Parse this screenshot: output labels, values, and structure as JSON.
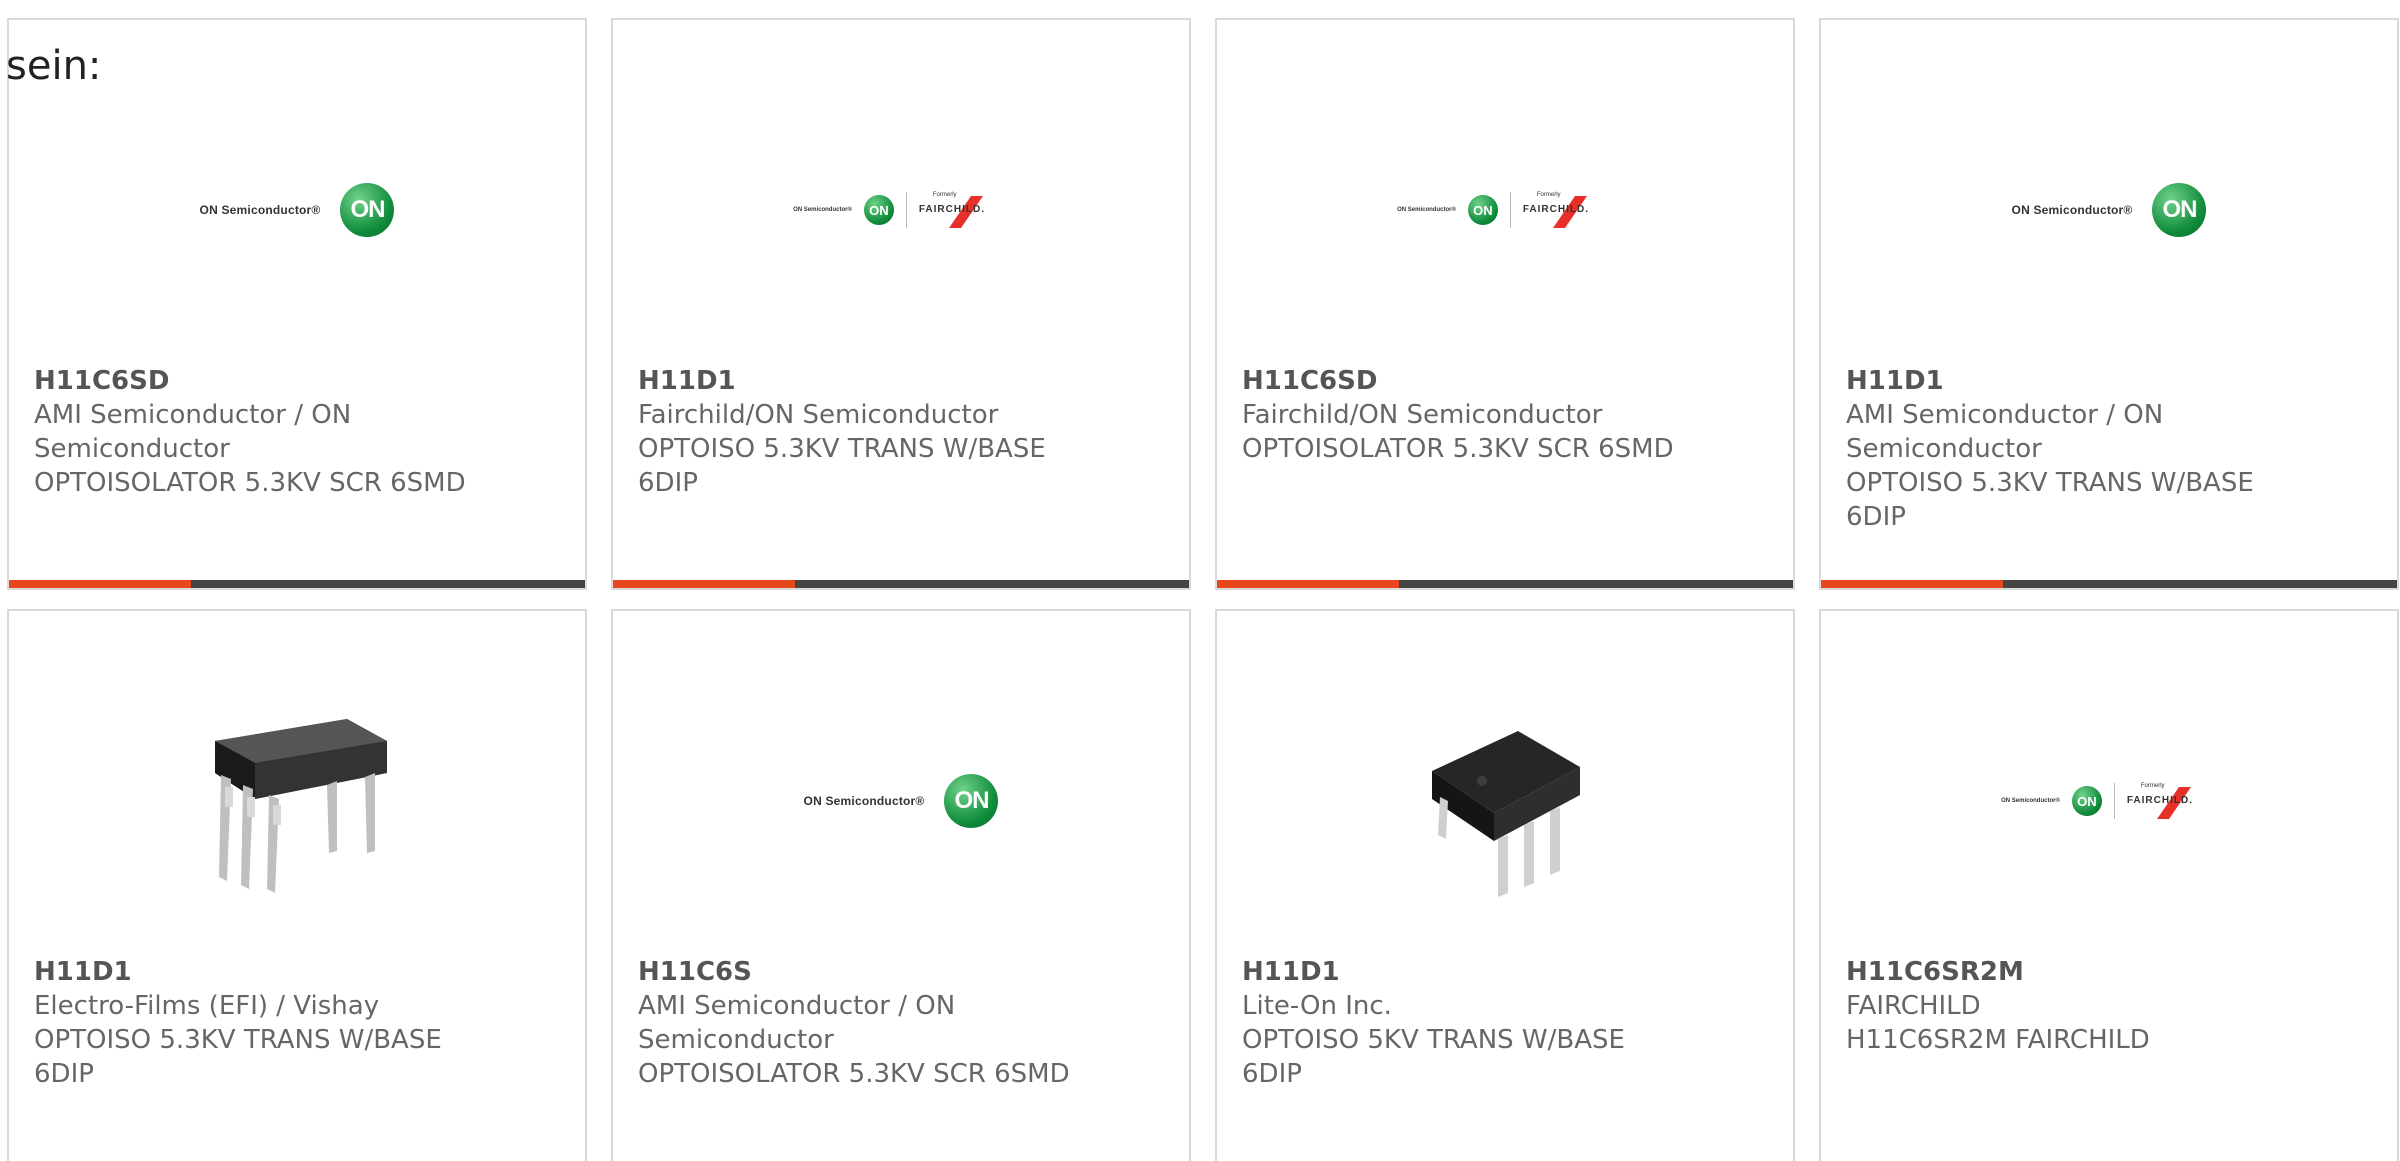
{
  "intro_text": "sein:",
  "brand_colors": {
    "accent": "#e8461c",
    "bar": "#444444",
    "on_green": "#0f8a3a",
    "fairchild_red": "#e8302a"
  },
  "products": [
    {
      "part_number": "H11C6SD",
      "manufacturer_lines": [
        "AMI Semiconductor / ON",
        "Semiconductor"
      ],
      "description_lines": [
        "OPTOISOLATOR 5.3KV SCR 6SMD"
      ],
      "image": "on-semiconductor-logo",
      "logo": {
        "brand": "ON Semiconductor®",
        "mark": "ON"
      }
    },
    {
      "part_number": "H11D1",
      "manufacturer_lines": [
        "Fairchild/ON Semiconductor"
      ],
      "description_lines": [
        "OPTOISO 5.3KV TRANS W/BASE",
        "6DIP"
      ],
      "image": "on-fairchild-logo",
      "logo": {
        "brand": "ON Semiconductor®",
        "mark": "ON",
        "small": "Formerly",
        "word": "FAIRCHILD."
      }
    },
    {
      "part_number": "H11C6SD",
      "manufacturer_lines": [
        "Fairchild/ON Semiconductor"
      ],
      "description_lines": [
        "OPTOISOLATOR 5.3KV SCR 6SMD"
      ],
      "image": "on-fairchild-logo",
      "logo": {
        "brand": "ON Semiconductor®",
        "mark": "ON",
        "small": "Formerly",
        "word": "FAIRCHILD."
      }
    },
    {
      "part_number": "H11D1",
      "manufacturer_lines": [
        "AMI Semiconductor / ON",
        "Semiconductor"
      ],
      "description_lines": [
        "OPTOISO 5.3KV TRANS W/BASE",
        "6DIP"
      ],
      "image": "on-semiconductor-logo",
      "logo": {
        "brand": "ON Semiconductor®",
        "mark": "ON"
      }
    },
    {
      "part_number": "H11D1",
      "manufacturer_lines": [
        "Electro-Films (EFI) / Vishay"
      ],
      "description_lines": [
        "OPTOISO 5.3KV TRANS W/BASE",
        "6DIP"
      ],
      "image": "dip6-chip-photo"
    },
    {
      "part_number": "H11C6S",
      "manufacturer_lines": [
        "AMI Semiconductor / ON",
        "Semiconductor"
      ],
      "description_lines": [
        "OPTOISOLATOR 5.3KV SCR 6SMD"
      ],
      "image": "on-semiconductor-logo",
      "logo": {
        "brand": "ON Semiconductor®",
        "mark": "ON"
      }
    },
    {
      "part_number": "H11D1",
      "manufacturer_lines": [
        "Lite-On Inc."
      ],
      "description_lines": [
        "OPTOISO 5KV TRANS W/BASE",
        "6DIP"
      ],
      "image": "dip6-chip-photo-angled"
    },
    {
      "part_number": "H11C6SR2M",
      "manufacturer_lines": [
        "FAIRCHILD"
      ],
      "description_lines": [
        "H11C6SR2M FAIRCHILD"
      ],
      "image": "on-fairchild-logo",
      "logo": {
        "brand": "ON Semiconductor®",
        "mark": "ON",
        "small": "Formerly",
        "word": "FAIRCHILD."
      }
    }
  ]
}
